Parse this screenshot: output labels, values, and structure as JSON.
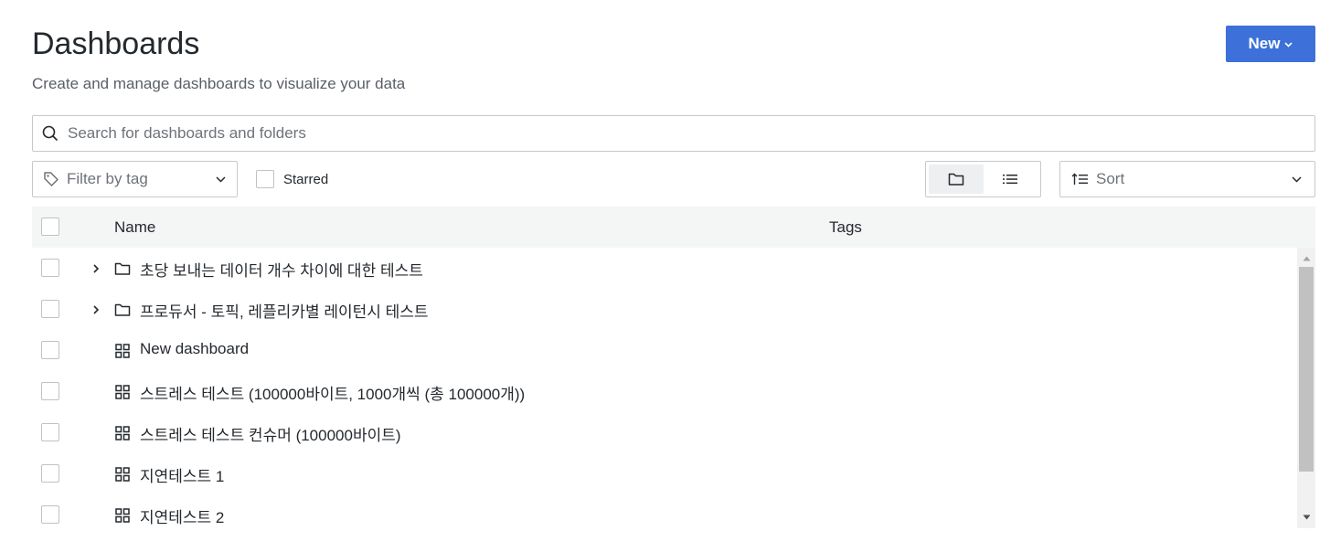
{
  "page": {
    "title": "Dashboards",
    "subtitle": "Create and manage dashboards to visualize your data"
  },
  "header": {
    "new_button_label": "New"
  },
  "search": {
    "placeholder": "Search for dashboards and folders",
    "value": ""
  },
  "filters": {
    "tag_placeholder": "Filter by tag",
    "starred_label": "Starred",
    "starred_checked": false,
    "view_mode": "folders",
    "sort_placeholder": "Sort"
  },
  "table": {
    "columns": {
      "name": "Name",
      "tags": "Tags"
    },
    "rows": [
      {
        "type": "folder",
        "name": "초당 보내는 데이터 개수 차이에 대한 테스트"
      },
      {
        "type": "folder",
        "name": "프로듀서 - 토픽, 레플리카별 레이턴시 테스트"
      },
      {
        "type": "dashboard",
        "name": "New dashboard"
      },
      {
        "type": "dashboard",
        "name": "스트레스 테스트 (100000바이트, 1000개씩 (총 100000개))"
      },
      {
        "type": "dashboard",
        "name": "스트레스 테스트 컨슈머 (100000바이트)"
      },
      {
        "type": "dashboard",
        "name": "지연테스트 1"
      },
      {
        "type": "dashboard",
        "name": "지연테스트 2"
      }
    ]
  },
  "colors": {
    "primary": "#3d71d9",
    "header_bg": "#f4f5f5",
    "border": "#c7c9cc",
    "text": "#24292e",
    "muted_text": "#6e7379"
  }
}
